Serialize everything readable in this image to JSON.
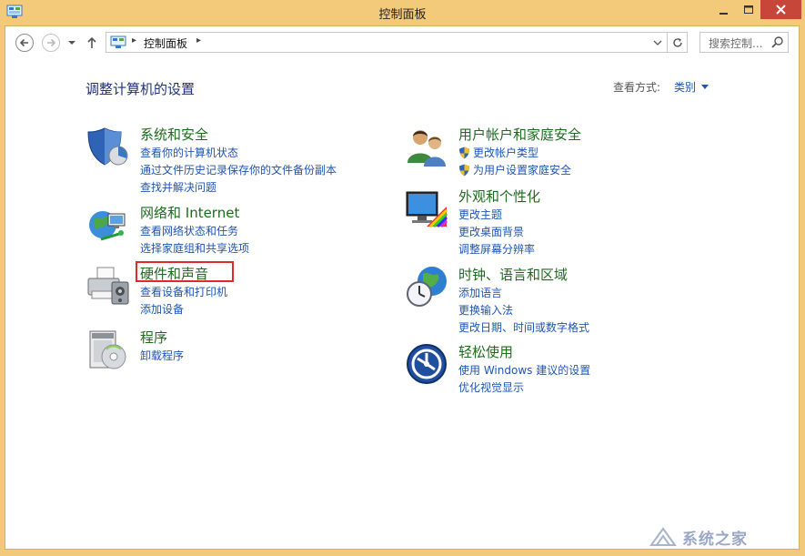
{
  "window": {
    "title": "控制面板"
  },
  "navigation": {
    "address_path": "控制面板",
    "search_placeholder": "搜索控制..."
  },
  "main": {
    "heading": "调整计算机的设置",
    "view_by_label": "查看方式:",
    "view_by_value": "类别"
  },
  "categories": [
    {
      "icon": "shield-pie-icon",
      "title": "系统和安全",
      "links": [
        "查看你的计算机状态",
        "通过文件历史记录保存你的文件备份副本",
        "查找并解决问题"
      ]
    },
    {
      "icon": "network-globe-icon",
      "title": "网络和 Internet",
      "links": [
        "查看网络状态和任务",
        "选择家庭组和共享选项"
      ]
    },
    {
      "icon": "printer-icon",
      "title": "硬件和声音",
      "highlighted": true,
      "links": [
        "查看设备和打印机",
        "添加设备"
      ]
    },
    {
      "icon": "programs-icon",
      "title": "程序",
      "links": [
        "卸载程序"
      ]
    },
    {
      "icon": "users-icon",
      "title": "用户帐户和家庭安全",
      "links": [
        "更改帐户类型",
        "为用户设置家庭安全"
      ],
      "link_icons": [
        "uac-shield-icon",
        "uac-shield-icon"
      ]
    },
    {
      "icon": "monitor-palette-icon",
      "title": "外观和个性化",
      "links": [
        "更改主题",
        "更改桌面背景",
        "调整屏幕分辨率"
      ]
    },
    {
      "icon": "clock-globe-icon",
      "title": "时钟、语言和区域",
      "links": [
        "添加语言",
        "更换输入法",
        "更改日期、时间或数字格式"
      ]
    },
    {
      "icon": "ease-of-access-icon",
      "title": "轻松使用",
      "links": [
        "使用 Windows 建议的设置",
        "优化视觉显示"
      ]
    }
  ],
  "watermark": {
    "text": "系统之家"
  },
  "colors": {
    "title_bar": "#f3c97a",
    "close_button": "#c7463a",
    "category_title": "#1d6b1d",
    "link": "#1f55b3",
    "heading": "#1e3287",
    "highlight_box": "#e0282f"
  }
}
